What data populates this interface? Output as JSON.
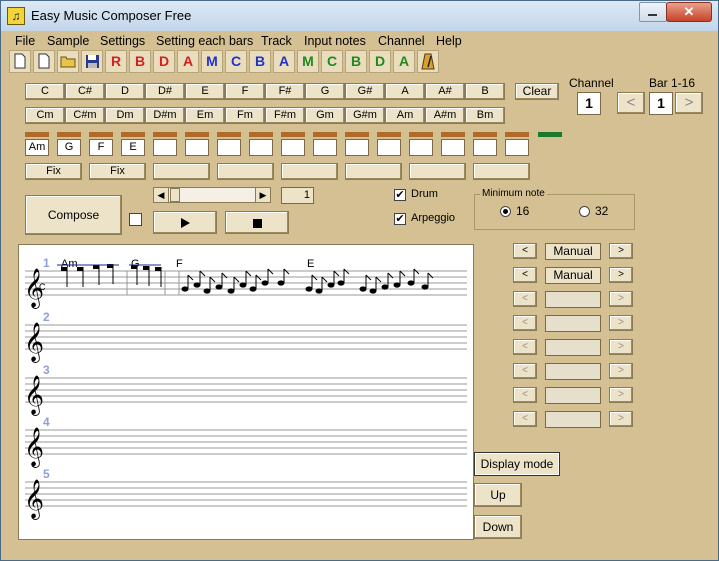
{
  "window": {
    "title": "Easy Music Composer Free",
    "close_glyph": "✕"
  },
  "menu": [
    {
      "label": "File"
    },
    {
      "label": "Sample"
    },
    {
      "label": "Settings"
    },
    {
      "label": "Setting each bars"
    },
    {
      "label": "Track"
    },
    {
      "label": "Input notes"
    },
    {
      "label": "Channel"
    },
    {
      "label": "Help"
    }
  ],
  "toolbar": {
    "letters": [
      {
        "t": "R",
        "c": "#d61f1f"
      },
      {
        "t": "B",
        "c": "#d61f1f"
      },
      {
        "t": "D",
        "c": "#d61f1f"
      },
      {
        "t": "A",
        "c": "#d61f1f"
      },
      {
        "t": "M",
        "c": "#2233cc"
      },
      {
        "t": "C",
        "c": "#2233cc"
      },
      {
        "t": "B",
        "c": "#2233cc"
      },
      {
        "t": "A",
        "c": "#2233cc"
      },
      {
        "t": "M",
        "c": "#1f8a1f"
      },
      {
        "t": "C",
        "c": "#1f8a1f"
      },
      {
        "t": "B",
        "c": "#1f8a1f"
      },
      {
        "t": "D",
        "c": "#1f8a1f"
      },
      {
        "t": "A",
        "c": "#1f8a1f"
      }
    ]
  },
  "chords_major": [
    "C",
    "C#",
    "D",
    "D#",
    "E",
    "F",
    "F#",
    "G",
    "G#",
    "A",
    "A#",
    "B"
  ],
  "chords_minor": [
    "Cm",
    "C#m",
    "Dm",
    "D#m",
    "Em",
    "Fm",
    "F#m",
    "Gm",
    "G#m",
    "Am",
    "A#m",
    "Bm"
  ],
  "clear_label": "Clear",
  "channel": {
    "label": "Channel",
    "value": "1"
  },
  "bar": {
    "label": "Bar 1-16",
    "value": "1",
    "prev": "<",
    "next": ">"
  },
  "selected_chords": [
    "Am",
    "G",
    "F",
    "E",
    "",
    "",
    "",
    "",
    "",
    "",
    "",
    "",
    "",
    "",
    "",
    ""
  ],
  "fix_buttons": [
    "Fix",
    "Fix",
    "",
    "",
    "",
    "",
    "",
    ""
  ],
  "compose_label": "Compose",
  "tempo_value": "1",
  "drum": {
    "label": "Drum",
    "checked": "✔"
  },
  "arpeggio": {
    "label": "Arpeggio",
    "checked": "✔"
  },
  "minimum_note": {
    "label": "Minimum note",
    "opt1": "16",
    "opt2": "32"
  },
  "staff": {
    "track_numbers": [
      "1",
      "2",
      "3",
      "4",
      "5"
    ],
    "chord_labels": [
      {
        "t": "Am"
      },
      {
        "t": "G"
      },
      {
        "t": "F"
      },
      {
        "t": "E"
      }
    ],
    "clef": "𝄞"
  },
  "tracks": [
    {
      "value": "Manual"
    },
    {
      "value": "Manual"
    },
    {
      "value": ""
    },
    {
      "value": ""
    },
    {
      "value": ""
    },
    {
      "value": ""
    },
    {
      "value": ""
    },
    {
      "value": ""
    }
  ],
  "arrow_left": "<",
  "arrow_right": ">",
  "display_mode_label": "Display mode",
  "up_label": "Up",
  "down_label": "Down"
}
